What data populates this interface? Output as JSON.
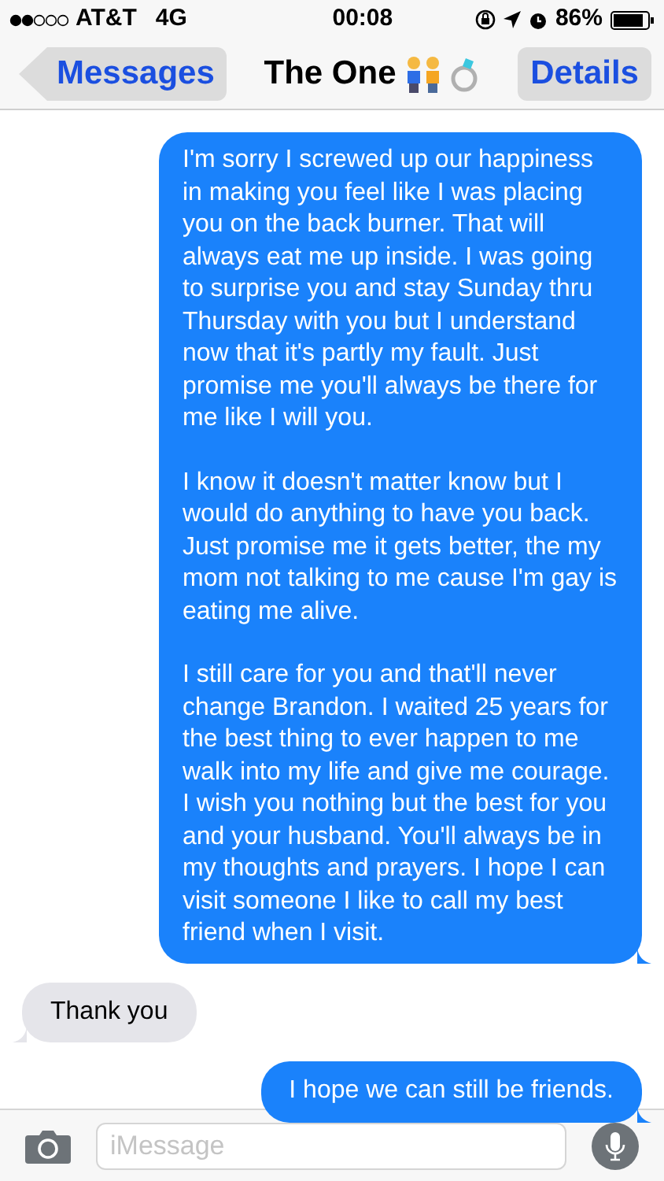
{
  "status_bar": {
    "carrier": "AT&T",
    "network": "4G",
    "time": "00:08",
    "battery": "86%"
  },
  "nav": {
    "back": "Messages",
    "title": "The One",
    "details": "Details"
  },
  "messages": [
    {
      "kind": "sent",
      "paragraphs": [
        "I'm sorry I screwed up our happiness in making you feel like I was placing you on the back burner. That will always eat me up inside. I was going to surprise you and stay Sunday thru Thursday with you but I understand now that it's partly my fault. Just promise me you'll always be there for me like I will you.",
        "I know it doesn't matter know but I would do anything to have you back. Just promise me it gets better, the my mom not talking to me cause I'm gay is eating me alive.",
        "I still care for you and that'll never change Brandon. I waited 25 years for the best thing to ever happen to me walk into my life and give me courage. I wish you nothing but the best for you and your husband. You'll always be in my thoughts and prayers. I hope I can visit someone I like to call my best friend when I visit."
      ]
    },
    {
      "kind": "received",
      "paragraphs": [
        "Thank you"
      ]
    },
    {
      "kind": "sent",
      "paragraphs": [
        "I hope we can still be friends."
      ]
    }
  ],
  "composer": {
    "placeholder": "iMessage"
  }
}
